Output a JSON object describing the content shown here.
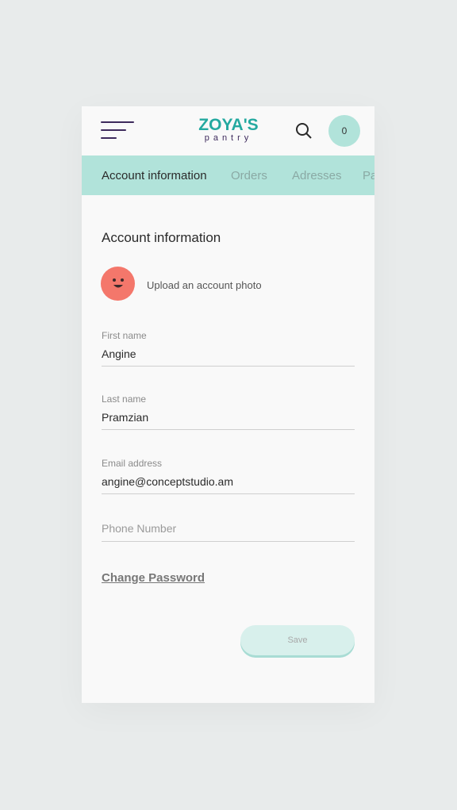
{
  "header": {
    "logo_top": "ZOYA'S",
    "logo_bottom": "pantry",
    "cart_count": "0"
  },
  "tabs": [
    {
      "label": "Account information",
      "active": true
    },
    {
      "label": "Orders"
    },
    {
      "label": "Adresses"
    },
    {
      "label": "Pa"
    }
  ],
  "section_title": "Account information",
  "upload_label": "Upload an account photo",
  "fields": [
    {
      "label": "First name",
      "value": "Angine"
    },
    {
      "label": "Last name",
      "value": "Pramzian"
    },
    {
      "label": "Email address",
      "value": "angine@conceptstudio.am"
    },
    {
      "placeholder": "Phone Number"
    }
  ],
  "change_password": "Change Password",
  "save_label": "Save",
  "colors": {
    "accent": "#b1e3da",
    "brand_teal": "#24a9a0",
    "brand_purple": "#3d2a5c",
    "avatar": "#f4776b"
  }
}
